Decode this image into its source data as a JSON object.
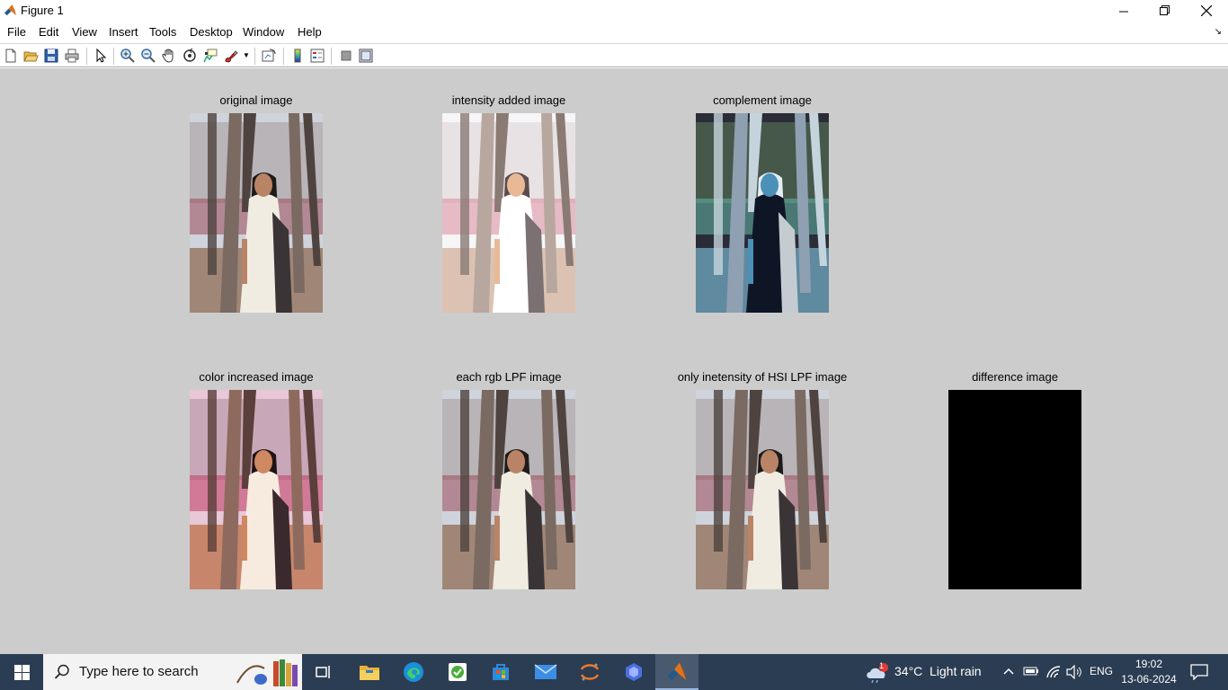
{
  "window": {
    "title": "Figure 1"
  },
  "menu": {
    "items": [
      "File",
      "Edit",
      "View",
      "Insert",
      "Tools",
      "Desktop",
      "Window",
      "Help"
    ]
  },
  "toolbar": {
    "buttons": [
      "new-figure",
      "open-file",
      "save",
      "print",
      "edit-plot",
      "zoom-in",
      "zoom-out",
      "pan",
      "rotate-3d",
      "data-cursor",
      "brush",
      "link-plot",
      "insert-colorbar",
      "insert-legend",
      "hide-plot-tools",
      "show-plot-tools"
    ]
  },
  "subplots": [
    {
      "title": "original image",
      "variant": "original"
    },
    {
      "title": "intensity added image",
      "variant": "bright"
    },
    {
      "title": "complement image",
      "variant": "complement"
    },
    {
      "title": "color increased image",
      "variant": "saturated"
    },
    {
      "title": "each rgb LPF image",
      "variant": "original"
    },
    {
      "title": "only inetensity of HSI LPF image",
      "variant": "original"
    },
    {
      "title": "difference image",
      "variant": "black"
    }
  ],
  "taskbar": {
    "search_placeholder": "Type here to search",
    "weather_badge": "1",
    "temperature": "34°C",
    "weather": "Light rain",
    "language": "ENG",
    "time": "19:02",
    "date": "13-06-2024"
  },
  "colors": {
    "figure_background": "#cccccc",
    "taskbar_background": "#2b3d52"
  }
}
